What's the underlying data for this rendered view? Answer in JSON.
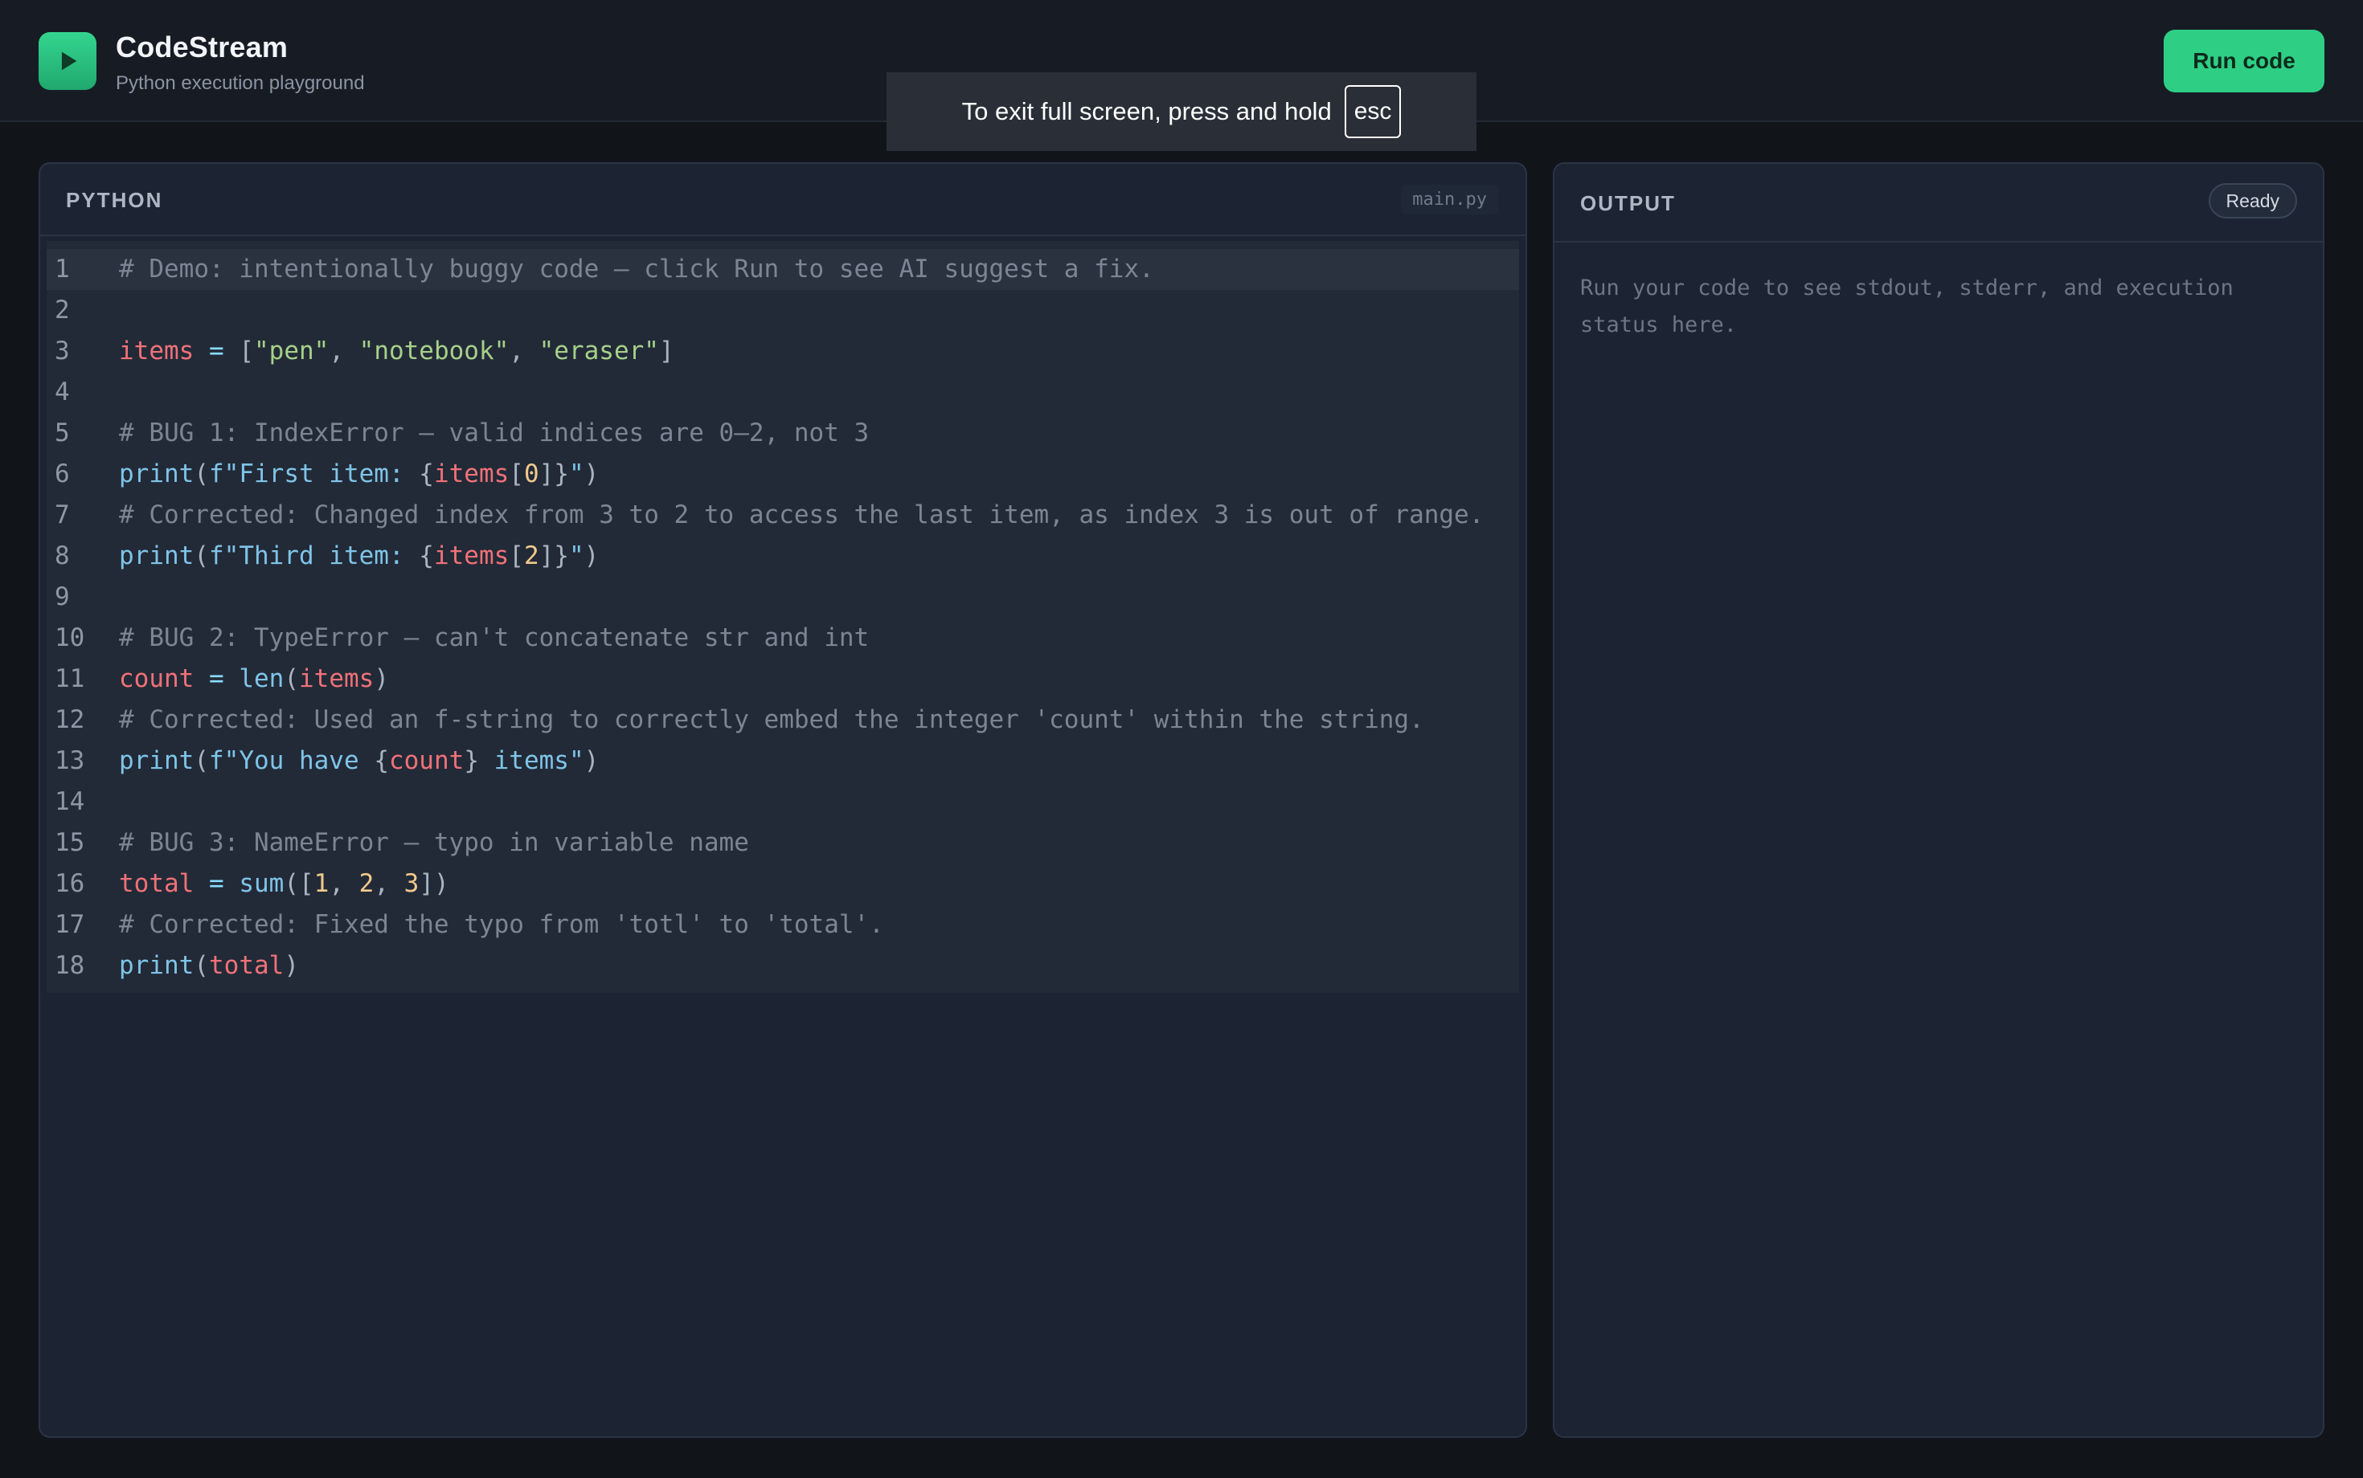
{
  "header": {
    "app_name": "CodeStream",
    "subtitle": "Python execution playground",
    "run_button": "Run code",
    "logo_icon": "play-icon"
  },
  "fullscreen_notice": {
    "text": "To exit full screen, press and hold",
    "key": "esc"
  },
  "editor": {
    "label": "PYTHON",
    "filename": "main.py",
    "lines": [
      {
        "n": "1",
        "tokens": [
          {
            "t": "cm",
            "v": "# Demo: intentionally buggy code — click Run to see AI suggest a fix."
          }
        ]
      },
      {
        "n": "2",
        "tokens": []
      },
      {
        "n": "3",
        "tokens": [
          {
            "t": "var",
            "v": "items"
          },
          {
            "t": "op",
            "v": " = "
          },
          {
            "t": "pun",
            "v": "["
          },
          {
            "t": "str",
            "v": "\"pen\""
          },
          {
            "t": "pun",
            "v": ", "
          },
          {
            "t": "str",
            "v": "\"notebook\""
          },
          {
            "t": "pun",
            "v": ", "
          },
          {
            "t": "str",
            "v": "\"eraser\""
          },
          {
            "t": "pun",
            "v": "]"
          }
        ]
      },
      {
        "n": "4",
        "tokens": []
      },
      {
        "n": "5",
        "tokens": [
          {
            "t": "cm",
            "v": "# BUG 1: IndexError — valid indices are 0–2, not 3"
          }
        ]
      },
      {
        "n": "6",
        "tokens": [
          {
            "t": "fn",
            "v": "print"
          },
          {
            "t": "pun",
            "v": "("
          },
          {
            "t": "fs",
            "v": "f\"First item: "
          },
          {
            "t": "pun",
            "v": "{"
          },
          {
            "t": "var",
            "v": "items"
          },
          {
            "t": "pun",
            "v": "["
          },
          {
            "t": "num",
            "v": "0"
          },
          {
            "t": "pun",
            "v": "]}"
          },
          {
            "t": "fs",
            "v": "\""
          },
          {
            "t": "pun",
            "v": ")"
          }
        ]
      },
      {
        "n": "7",
        "tokens": [
          {
            "t": "cm",
            "v": "# Corrected: Changed index from 3 to 2 to access the last item, as index 3 is out of range."
          }
        ]
      },
      {
        "n": "8",
        "tokens": [
          {
            "t": "fn",
            "v": "print"
          },
          {
            "t": "pun",
            "v": "("
          },
          {
            "t": "fs",
            "v": "f\"Third item: "
          },
          {
            "t": "pun",
            "v": "{"
          },
          {
            "t": "var",
            "v": "items"
          },
          {
            "t": "pun",
            "v": "["
          },
          {
            "t": "num",
            "v": "2"
          },
          {
            "t": "pun",
            "v": "]}"
          },
          {
            "t": "fs",
            "v": "\""
          },
          {
            "t": "pun",
            "v": ")"
          }
        ]
      },
      {
        "n": "9",
        "tokens": []
      },
      {
        "n": "10",
        "tokens": [
          {
            "t": "cm",
            "v": "# BUG 2: TypeError — can't concatenate str and int"
          }
        ]
      },
      {
        "n": "11",
        "tokens": [
          {
            "t": "var",
            "v": "count"
          },
          {
            "t": "op",
            "v": " = "
          },
          {
            "t": "fn",
            "v": "len"
          },
          {
            "t": "pun",
            "v": "("
          },
          {
            "t": "var",
            "v": "items"
          },
          {
            "t": "pun",
            "v": ")"
          }
        ]
      },
      {
        "n": "12",
        "tokens": [
          {
            "t": "cm",
            "v": "# Corrected: Used an f-string to correctly embed the integer 'count' within the string."
          }
        ]
      },
      {
        "n": "13",
        "tokens": [
          {
            "t": "fn",
            "v": "print"
          },
          {
            "t": "pun",
            "v": "("
          },
          {
            "t": "fs",
            "v": "f\"You have "
          },
          {
            "t": "pun",
            "v": "{"
          },
          {
            "t": "var",
            "v": "count"
          },
          {
            "t": "pun",
            "v": "}"
          },
          {
            "t": "fs",
            "v": " items\""
          },
          {
            "t": "pun",
            "v": ")"
          }
        ]
      },
      {
        "n": "14",
        "tokens": []
      },
      {
        "n": "15",
        "tokens": [
          {
            "t": "cm",
            "v": "# BUG 3: NameError — typo in variable name"
          }
        ]
      },
      {
        "n": "16",
        "tokens": [
          {
            "t": "var",
            "v": "total"
          },
          {
            "t": "op",
            "v": " = "
          },
          {
            "t": "fn",
            "v": "sum"
          },
          {
            "t": "pun",
            "v": "(["
          },
          {
            "t": "num",
            "v": "1"
          },
          {
            "t": "pun",
            "v": ", "
          },
          {
            "t": "num",
            "v": "2"
          },
          {
            "t": "pun",
            "v": ", "
          },
          {
            "t": "num",
            "v": "3"
          },
          {
            "t": "pun",
            "v": "])"
          }
        ]
      },
      {
        "n": "17",
        "tokens": [
          {
            "t": "cm",
            "v": "# Corrected: Fixed the typo from 'totl' to 'total'."
          }
        ]
      },
      {
        "n": "18",
        "tokens": [
          {
            "t": "fn",
            "v": "print"
          },
          {
            "t": "pun",
            "v": "("
          },
          {
            "t": "var",
            "v": "total"
          },
          {
            "t": "pun",
            "v": ")"
          }
        ]
      }
    ]
  },
  "output": {
    "label": "OUTPUT",
    "status": "Ready",
    "placeholder": "Run your code to see stdout, stderr, and execution status here."
  },
  "colors": {
    "accent": "#2ecf85",
    "background": "#111419",
    "panel": "#1c2433"
  }
}
